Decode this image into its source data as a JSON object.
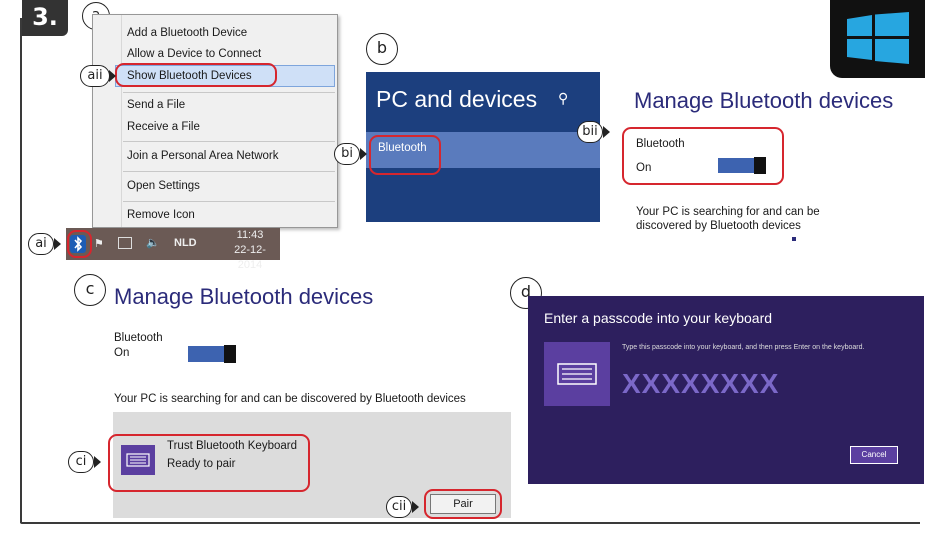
{
  "step": "3.",
  "labels": {
    "a": "a",
    "ai": "ai",
    "aii": "aii",
    "b": "b",
    "bi": "bi",
    "bii": "bii",
    "c": "c",
    "ci": "ci",
    "cii": "cii",
    "d": "d"
  },
  "context_menu": {
    "items": [
      "Add a Bluetooth Device",
      "Allow a Device to Connect",
      "Show Bluetooth Devices",
      "Send a File",
      "Receive a File",
      "Join a Personal Area Network",
      "Open Settings",
      "Remove Icon"
    ]
  },
  "taskbar": {
    "language": "NLD",
    "time": "11:43",
    "date": "22-12-2014",
    "icons": [
      "bluetooth-icon",
      "flag-icon",
      "network-icon",
      "speaker-icon"
    ]
  },
  "pc_devices": {
    "title": "PC and devices",
    "selected_item": "Bluetooth"
  },
  "manage_right": {
    "title": "Manage Bluetooth devices",
    "bluetooth_label": "Bluetooth",
    "state": "On",
    "status_line1": "Your PC is searching for and can be",
    "status_line2": "discovered by Bluetooth devices"
  },
  "manage_left": {
    "title": "Manage Bluetooth devices",
    "bluetooth_label": "Bluetooth",
    "state": "On",
    "status": "Your PC is searching for and can be discovered by Bluetooth devices",
    "device_name": "Trust Bluetooth Keyboard",
    "device_status": "Ready to pair",
    "pair_label": "Pair"
  },
  "passcode": {
    "heading": "Enter a passcode into your keyboard",
    "instruction": "Type this passcode into your keyboard, and then press Enter on the keyboard.",
    "code": "XXXXXXXX",
    "cancel_label": "Cancel"
  },
  "colors": {
    "accent_red": "#d6262e",
    "settings_blue": "#1c3f7e",
    "dialog_purple": "#2d1f5e",
    "tile_purple": "#5b3fa0",
    "title_navy": "#2b2b7a"
  }
}
